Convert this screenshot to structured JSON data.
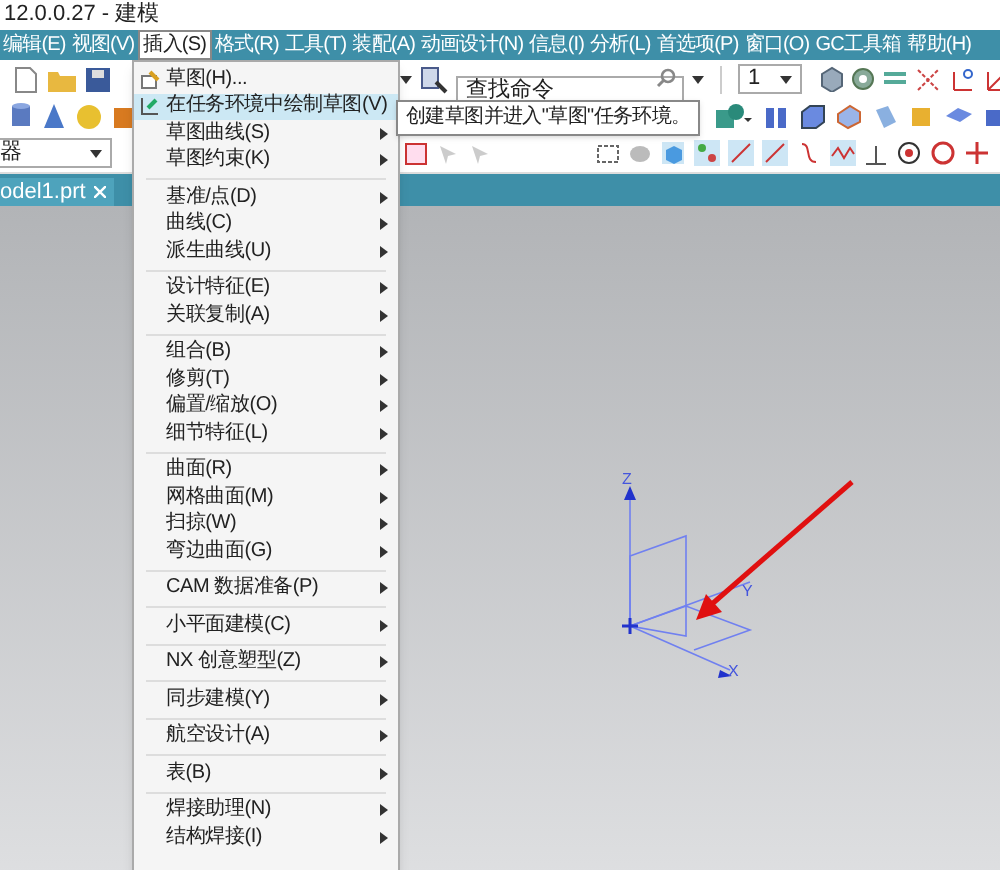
{
  "window": {
    "title": "12.0.0.27 - 建模"
  },
  "menu_bar": [
    {
      "label": "编辑(E)",
      "selected": false
    },
    {
      "label": "视图(V)",
      "selected": false
    },
    {
      "label": "插入(S)",
      "selected": true
    },
    {
      "label": "格式(R)",
      "selected": false
    },
    {
      "label": "工具(T)",
      "selected": false
    },
    {
      "label": "装配(A)",
      "selected": false
    },
    {
      "label": "动画设计(N)",
      "selected": false
    },
    {
      "label": "信息(I)",
      "selected": false
    },
    {
      "label": "分析(L)",
      "selected": false
    },
    {
      "label": "首选项(P)",
      "selected": false
    },
    {
      "label": "窗口(O)",
      "selected": false
    },
    {
      "label": "GC工具箱",
      "selected": false
    },
    {
      "label": "帮助(H)",
      "selected": false
    }
  ],
  "toolbar": {
    "search": {
      "placeholder": "查找命令"
    },
    "layer_combo": {
      "value": "1"
    },
    "filter_combo": {
      "value": "器"
    }
  },
  "document_tab": {
    "label": "odel1.prt"
  },
  "insert_menu": {
    "groups": [
      [
        {
          "label": "草图(H)...",
          "submenu": false,
          "selected": false
        },
        {
          "label": "在任务环境中绘制草图(V)",
          "submenu": false,
          "selected": true
        },
        {
          "label": "草图曲线(S)",
          "submenu": true,
          "selected": false
        },
        {
          "label": "草图约束(K)",
          "submenu": true,
          "selected": false
        }
      ],
      [
        {
          "label": "基准/点(D)",
          "submenu": true,
          "selected": false
        },
        {
          "label": "曲线(C)",
          "submenu": true,
          "selected": false
        },
        {
          "label": "派生曲线(U)",
          "submenu": true,
          "selected": false
        }
      ],
      [
        {
          "label": "设计特征(E)",
          "submenu": true,
          "selected": false
        },
        {
          "label": "关联复制(A)",
          "submenu": true,
          "selected": false
        }
      ],
      [
        {
          "label": "组合(B)",
          "submenu": true,
          "selected": false
        },
        {
          "label": "修剪(T)",
          "submenu": true,
          "selected": false
        },
        {
          "label": "偏置/缩放(O)",
          "submenu": true,
          "selected": false
        },
        {
          "label": "细节特征(L)",
          "submenu": true,
          "selected": false
        }
      ],
      [
        {
          "label": "曲面(R)",
          "submenu": true,
          "selected": false
        },
        {
          "label": "网格曲面(M)",
          "submenu": true,
          "selected": false
        },
        {
          "label": "扫掠(W)",
          "submenu": true,
          "selected": false
        },
        {
          "label": "弯边曲面(G)",
          "submenu": true,
          "selected": false
        }
      ],
      [
        {
          "label": "CAM 数据准备(P)",
          "submenu": true,
          "selected": false
        }
      ],
      [
        {
          "label": "小平面建模(C)",
          "submenu": true,
          "selected": false
        }
      ],
      [
        {
          "label": "NX 创意塑型(Z)",
          "submenu": true,
          "selected": false
        }
      ],
      [
        {
          "label": "同步建模(Y)",
          "submenu": true,
          "selected": false
        }
      ],
      [
        {
          "label": "航空设计(A)",
          "submenu": true,
          "selected": false
        }
      ],
      [
        {
          "label": "表(B)",
          "submenu": true,
          "selected": false
        }
      ],
      [
        {
          "label": "焊接助理(N)",
          "submenu": true,
          "selected": false
        },
        {
          "label": "结构焊接(I)",
          "submenu": true,
          "selected": false
        }
      ]
    ]
  },
  "tooltip": {
    "text": "创建草图并进入\"草图\"任务环境。"
  },
  "viewport": {
    "axes": [
      {
        "label": "Z"
      },
      {
        "label": "Y"
      },
      {
        "label": "X"
      }
    ]
  }
}
